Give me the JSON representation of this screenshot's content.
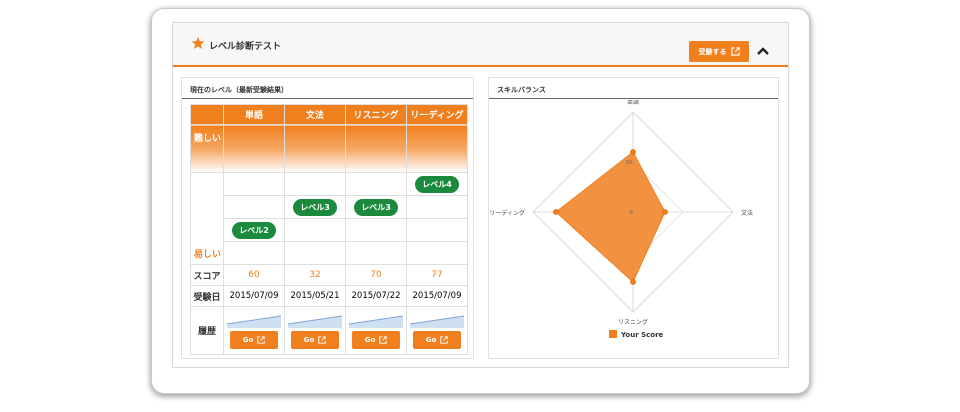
{
  "header": {
    "title": "レベル診断テスト",
    "take_test_label": "受験する"
  },
  "left": {
    "title": "現在のレベル（最新受験結果）",
    "hard_label": "難しい",
    "easy_label": "易しい",
    "columns": [
      "単語",
      "文法",
      "リスニング",
      "リーディング"
    ],
    "level_rows": [
      [
        "",
        "",
        "",
        "レベル4"
      ],
      [
        "",
        "レベル3",
        "レベル3",
        ""
      ],
      [
        "レベル2",
        "",
        "",
        ""
      ]
    ],
    "score_label": "スコア",
    "scores": [
      "60",
      "32",
      "70",
      "77"
    ],
    "date_label": "受験日",
    "dates": [
      "2015/07/09",
      "2015/05/21",
      "2015/07/22",
      "2015/07/09"
    ],
    "history_label": "履歴",
    "go_label": "Go"
  },
  "right": {
    "title": "スキルバランス",
    "legend": "Your Score",
    "series_color": "#f07f1e"
  },
  "chart_data": {
    "type": "radar",
    "axes": [
      "単語",
      "文法",
      "リスニング",
      "リーディング"
    ],
    "tick_labels": [
      "0",
      "50"
    ],
    "range": [
      0,
      100
    ],
    "series": [
      {
        "name": "Your Score",
        "values": [
          60,
          32,
          70,
          77
        ]
      }
    ]
  }
}
